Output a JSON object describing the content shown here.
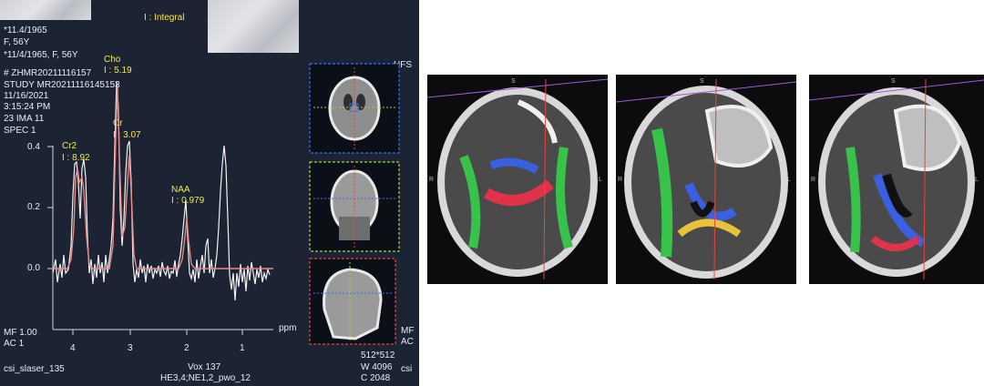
{
  "spectroscopy": {
    "mode": "I : Integral",
    "patient_lines": [
      "*11.4/1965",
      "F, 56Y",
      "*11/4/1965, F, 56Y"
    ],
    "study_lines": [
      "# ZHMR20211116157",
      "STUDY MR20211116145153",
      "11/16/2021",
      "3:15:24 PM",
      "23 IMA 11",
      "SPEC 1"
    ],
    "orientation": "HFS",
    "peaks": [
      {
        "name": "Cho",
        "value": "I : 5.19"
      },
      {
        "name": "Cr",
        "value": "I : 3.07"
      },
      {
        "name": "Cr2",
        "value": "I : 8.92"
      },
      {
        "name": "NAA",
        "value": "I : 0.979"
      }
    ],
    "y_ticks": [
      "0.4",
      "0.2",
      "0.0"
    ],
    "x_ticks": [
      "4",
      "3",
      "2",
      "1"
    ],
    "x_unit": "ppm",
    "left_bottom": [
      "MF 1.00",
      "AC 1"
    ],
    "sequence": "csi_slaser_135",
    "vox": "Vox 137",
    "coil": "HE3,4;NE1,2_pwo_12",
    "matrix": "512*512",
    "window_w": "W  4096",
    "window_c": "C  2048",
    "right_edge": [
      "MF",
      "AC",
      "csi"
    ],
    "localizer_colors": [
      "#3b6cf0",
      "#9ad648",
      "#e8453c"
    ]
  },
  "dti": {
    "panels": [
      {
        "labels": [
          "S",
          "R",
          "L"
        ]
      },
      {
        "labels": [
          "S",
          "R",
          "L"
        ]
      },
      {
        "labels": [
          "S",
          "R",
          "L"
        ]
      }
    ]
  }
}
